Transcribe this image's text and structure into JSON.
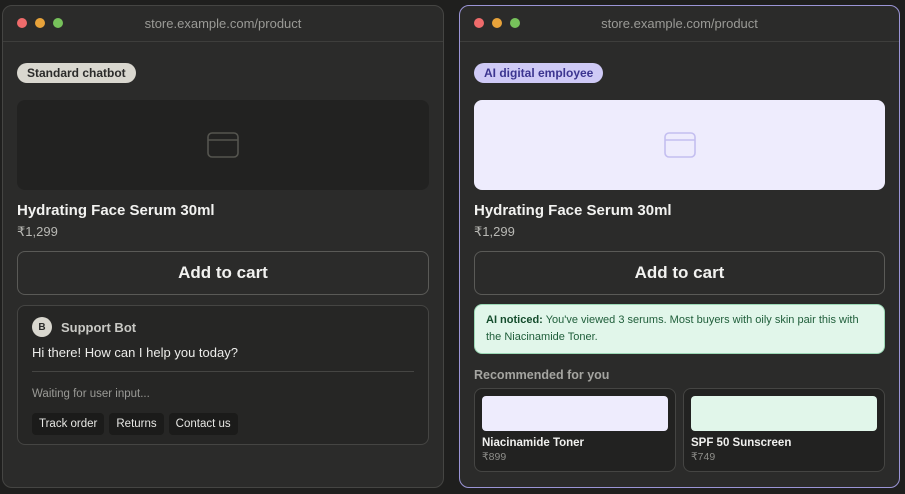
{
  "left_window": {
    "url": "store.example.com/product",
    "badge": "Standard chatbot",
    "product": {
      "title": "Hydrating Face Serum 30ml",
      "price": "₹1,299",
      "image_icon": "image-placeholder-icon"
    },
    "add_to_cart_label": "Add to cart",
    "chat": {
      "avatar_initial": "B",
      "bot_name": "Support Bot",
      "greeting": "Hi there! How can I help you today?",
      "status": "Waiting for user input...",
      "quick_replies": [
        "Track order",
        "Returns",
        "Contact us"
      ]
    }
  },
  "right_window": {
    "url": "store.example.com/product",
    "badge": "AI digital employee",
    "product": {
      "title": "Hydrating Face Serum 30ml",
      "price": "₹1,299",
      "image_icon": "image-placeholder-icon"
    },
    "add_to_cart_label": "Add to cart",
    "ai_note": {
      "label": "AI noticed:",
      "text": "You've viewed 3 serums. Most buyers with oily skin pair this with the Niacinamide Toner."
    },
    "recommendations_heading": "Recommended for you",
    "recommendations": [
      {
        "name": "Niacinamide Toner",
        "price": "₹899",
        "swatch_color": "#eeecfd"
      },
      {
        "name": "SPF 50 Sunscreen",
        "price": "₹749",
        "swatch_color": "#e1f6ea"
      }
    ]
  },
  "colors": {
    "traffic_red": "#ef6b6b",
    "traffic_yellow": "#e8a33a",
    "traffic_green": "#77c25b",
    "ai_accent": "#9b95d6",
    "ai_note_bg": "#e1f6ea"
  }
}
